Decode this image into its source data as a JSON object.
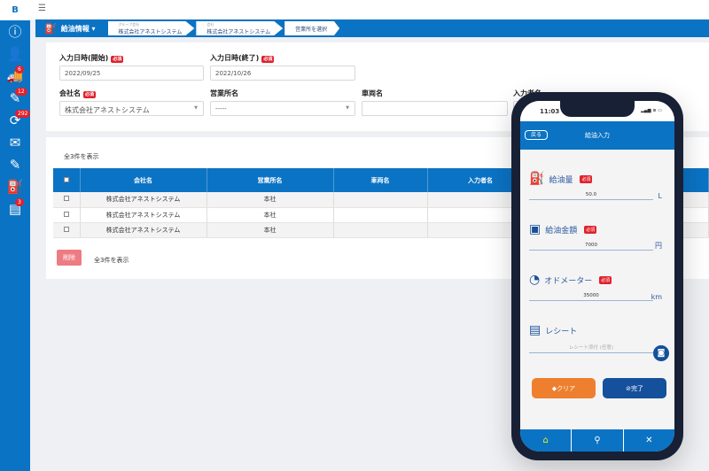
{
  "sidebar": {
    "logo": "B",
    "items": [
      {
        "icon": "info-icon",
        "glyph": "ⓘ",
        "badge": null
      },
      {
        "icon": "driver-icon",
        "glyph": "👤",
        "badge": null
      },
      {
        "icon": "truck-icon",
        "glyph": "🚚",
        "badge": "6"
      },
      {
        "icon": "report-icon",
        "glyph": "✎",
        "badge": "12"
      },
      {
        "icon": "sync-icon",
        "glyph": "⟳",
        "badge": "292"
      },
      {
        "icon": "mail-icon",
        "glyph": "✉",
        "badge": null
      },
      {
        "icon": "edit-doc-icon",
        "glyph": "✎",
        "badge": null
      },
      {
        "icon": "fuel-icon",
        "glyph": "⛽",
        "badge": null
      },
      {
        "icon": "doc-icon",
        "glyph": "▤",
        "badge": "3"
      }
    ]
  },
  "header": {
    "menu": "給油情報 ▾",
    "breadcrumbs": [
      {
        "sub": "グループ会社",
        "label": "株式会社アネストシステム"
      },
      {
        "sub": "会社",
        "label": "株式会社アネストシステム"
      },
      {
        "sub": "",
        "label": "営業所を選択"
      }
    ]
  },
  "form": {
    "required": "必須",
    "start_label": "入力日時(開始)",
    "start_value": "2022/09/25",
    "end_label": "入力日時(終了)",
    "end_value": "2022/10/26",
    "company_label": "会社名",
    "company_value": "株式会社アネストシステム",
    "office_label": "営業所名",
    "office_value": "-----",
    "vehicle_label": "車両名",
    "vehicle_value": "",
    "inputter_label": "入力者名",
    "inputter_value": ""
  },
  "table": {
    "count_top": "全3件を表示",
    "headers": [
      "会社名",
      "営業所名",
      "車両名",
      "入力者名"
    ],
    "rows": [
      [
        "株式会社アネストシステム",
        "本社",
        "",
        ""
      ],
      [
        "株式会社アネストシステム",
        "本社",
        "",
        ""
      ],
      [
        "株式会社アネストシステム",
        "本社",
        "",
        ""
      ]
    ],
    "delete_label": "削除",
    "count_bottom": "全3件を表示"
  },
  "phone": {
    "time": "11:03",
    "status": "▂▄▆ ≋ ▭",
    "back": "戻る",
    "title": "給油入力",
    "fields": [
      {
        "label": "給油量",
        "required": true,
        "value": "50.0",
        "unit": "L"
      },
      {
        "label": "給油金額",
        "required": true,
        "value": "7000",
        "unit": "円"
      },
      {
        "label": "オドメーター",
        "required": true,
        "value": "35000",
        "unit": "km"
      },
      {
        "label": "レシート",
        "required": false,
        "value": "レシート添付 (任意)",
        "unit": ""
      }
    ],
    "clear": "クリア",
    "done": "完了",
    "colors": {
      "clear": "#ee7f2f",
      "done": "#14509c",
      "accent": "#0b73c4"
    }
  }
}
